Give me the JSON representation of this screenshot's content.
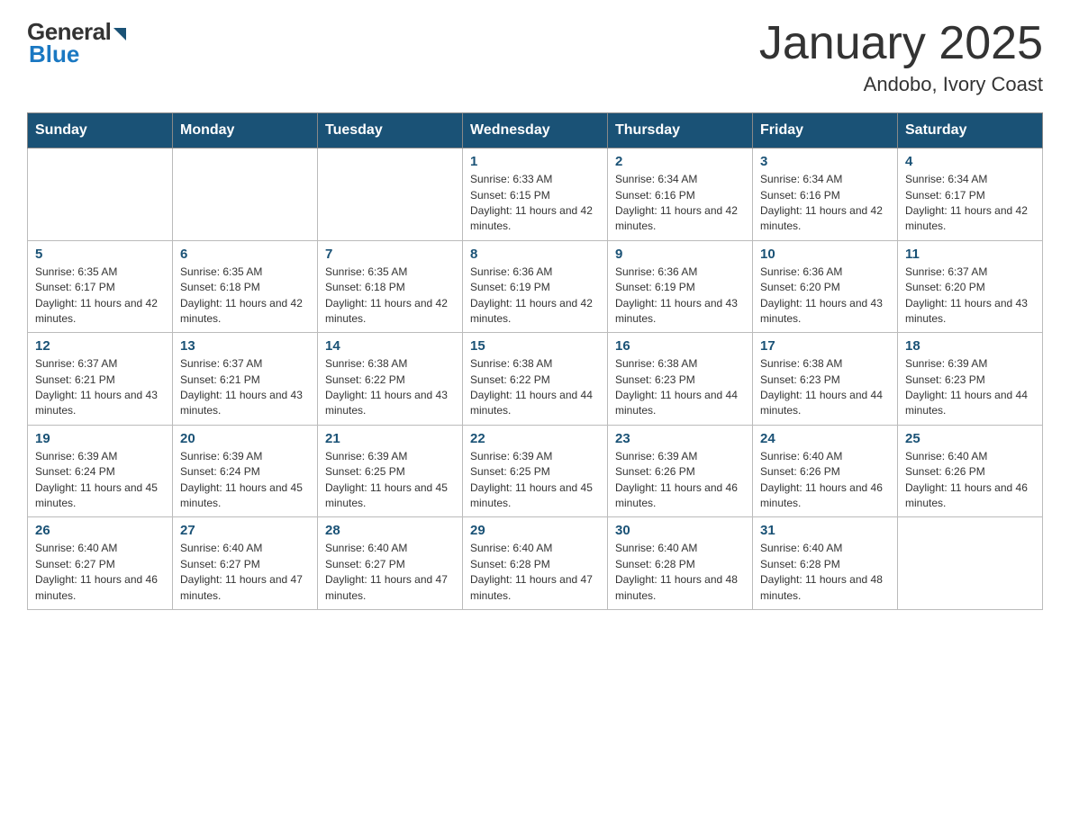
{
  "logo": {
    "general": "General",
    "blue": "Blue",
    "arrow": "▶"
  },
  "header": {
    "month": "January 2025",
    "location": "Andobo, Ivory Coast"
  },
  "weekdays": [
    "Sunday",
    "Monday",
    "Tuesday",
    "Wednesday",
    "Thursday",
    "Friday",
    "Saturday"
  ],
  "weeks": [
    {
      "days": [
        {
          "num": "",
          "info": ""
        },
        {
          "num": "",
          "info": ""
        },
        {
          "num": "",
          "info": ""
        },
        {
          "num": "1",
          "info": "Sunrise: 6:33 AM\nSunset: 6:15 PM\nDaylight: 11 hours and 42 minutes."
        },
        {
          "num": "2",
          "info": "Sunrise: 6:34 AM\nSunset: 6:16 PM\nDaylight: 11 hours and 42 minutes."
        },
        {
          "num": "3",
          "info": "Sunrise: 6:34 AM\nSunset: 6:16 PM\nDaylight: 11 hours and 42 minutes."
        },
        {
          "num": "4",
          "info": "Sunrise: 6:34 AM\nSunset: 6:17 PM\nDaylight: 11 hours and 42 minutes."
        }
      ]
    },
    {
      "days": [
        {
          "num": "5",
          "info": "Sunrise: 6:35 AM\nSunset: 6:17 PM\nDaylight: 11 hours and 42 minutes."
        },
        {
          "num": "6",
          "info": "Sunrise: 6:35 AM\nSunset: 6:18 PM\nDaylight: 11 hours and 42 minutes."
        },
        {
          "num": "7",
          "info": "Sunrise: 6:35 AM\nSunset: 6:18 PM\nDaylight: 11 hours and 42 minutes."
        },
        {
          "num": "8",
          "info": "Sunrise: 6:36 AM\nSunset: 6:19 PM\nDaylight: 11 hours and 42 minutes."
        },
        {
          "num": "9",
          "info": "Sunrise: 6:36 AM\nSunset: 6:19 PM\nDaylight: 11 hours and 43 minutes."
        },
        {
          "num": "10",
          "info": "Sunrise: 6:36 AM\nSunset: 6:20 PM\nDaylight: 11 hours and 43 minutes."
        },
        {
          "num": "11",
          "info": "Sunrise: 6:37 AM\nSunset: 6:20 PM\nDaylight: 11 hours and 43 minutes."
        }
      ]
    },
    {
      "days": [
        {
          "num": "12",
          "info": "Sunrise: 6:37 AM\nSunset: 6:21 PM\nDaylight: 11 hours and 43 minutes."
        },
        {
          "num": "13",
          "info": "Sunrise: 6:37 AM\nSunset: 6:21 PM\nDaylight: 11 hours and 43 minutes."
        },
        {
          "num": "14",
          "info": "Sunrise: 6:38 AM\nSunset: 6:22 PM\nDaylight: 11 hours and 43 minutes."
        },
        {
          "num": "15",
          "info": "Sunrise: 6:38 AM\nSunset: 6:22 PM\nDaylight: 11 hours and 44 minutes."
        },
        {
          "num": "16",
          "info": "Sunrise: 6:38 AM\nSunset: 6:23 PM\nDaylight: 11 hours and 44 minutes."
        },
        {
          "num": "17",
          "info": "Sunrise: 6:38 AM\nSunset: 6:23 PM\nDaylight: 11 hours and 44 minutes."
        },
        {
          "num": "18",
          "info": "Sunrise: 6:39 AM\nSunset: 6:23 PM\nDaylight: 11 hours and 44 minutes."
        }
      ]
    },
    {
      "days": [
        {
          "num": "19",
          "info": "Sunrise: 6:39 AM\nSunset: 6:24 PM\nDaylight: 11 hours and 45 minutes."
        },
        {
          "num": "20",
          "info": "Sunrise: 6:39 AM\nSunset: 6:24 PM\nDaylight: 11 hours and 45 minutes."
        },
        {
          "num": "21",
          "info": "Sunrise: 6:39 AM\nSunset: 6:25 PM\nDaylight: 11 hours and 45 minutes."
        },
        {
          "num": "22",
          "info": "Sunrise: 6:39 AM\nSunset: 6:25 PM\nDaylight: 11 hours and 45 minutes."
        },
        {
          "num": "23",
          "info": "Sunrise: 6:39 AM\nSunset: 6:26 PM\nDaylight: 11 hours and 46 minutes."
        },
        {
          "num": "24",
          "info": "Sunrise: 6:40 AM\nSunset: 6:26 PM\nDaylight: 11 hours and 46 minutes."
        },
        {
          "num": "25",
          "info": "Sunrise: 6:40 AM\nSunset: 6:26 PM\nDaylight: 11 hours and 46 minutes."
        }
      ]
    },
    {
      "days": [
        {
          "num": "26",
          "info": "Sunrise: 6:40 AM\nSunset: 6:27 PM\nDaylight: 11 hours and 46 minutes."
        },
        {
          "num": "27",
          "info": "Sunrise: 6:40 AM\nSunset: 6:27 PM\nDaylight: 11 hours and 47 minutes."
        },
        {
          "num": "28",
          "info": "Sunrise: 6:40 AM\nSunset: 6:27 PM\nDaylight: 11 hours and 47 minutes."
        },
        {
          "num": "29",
          "info": "Sunrise: 6:40 AM\nSunset: 6:28 PM\nDaylight: 11 hours and 47 minutes."
        },
        {
          "num": "30",
          "info": "Sunrise: 6:40 AM\nSunset: 6:28 PM\nDaylight: 11 hours and 48 minutes."
        },
        {
          "num": "31",
          "info": "Sunrise: 6:40 AM\nSunset: 6:28 PM\nDaylight: 11 hours and 48 minutes."
        },
        {
          "num": "",
          "info": ""
        }
      ]
    }
  ]
}
